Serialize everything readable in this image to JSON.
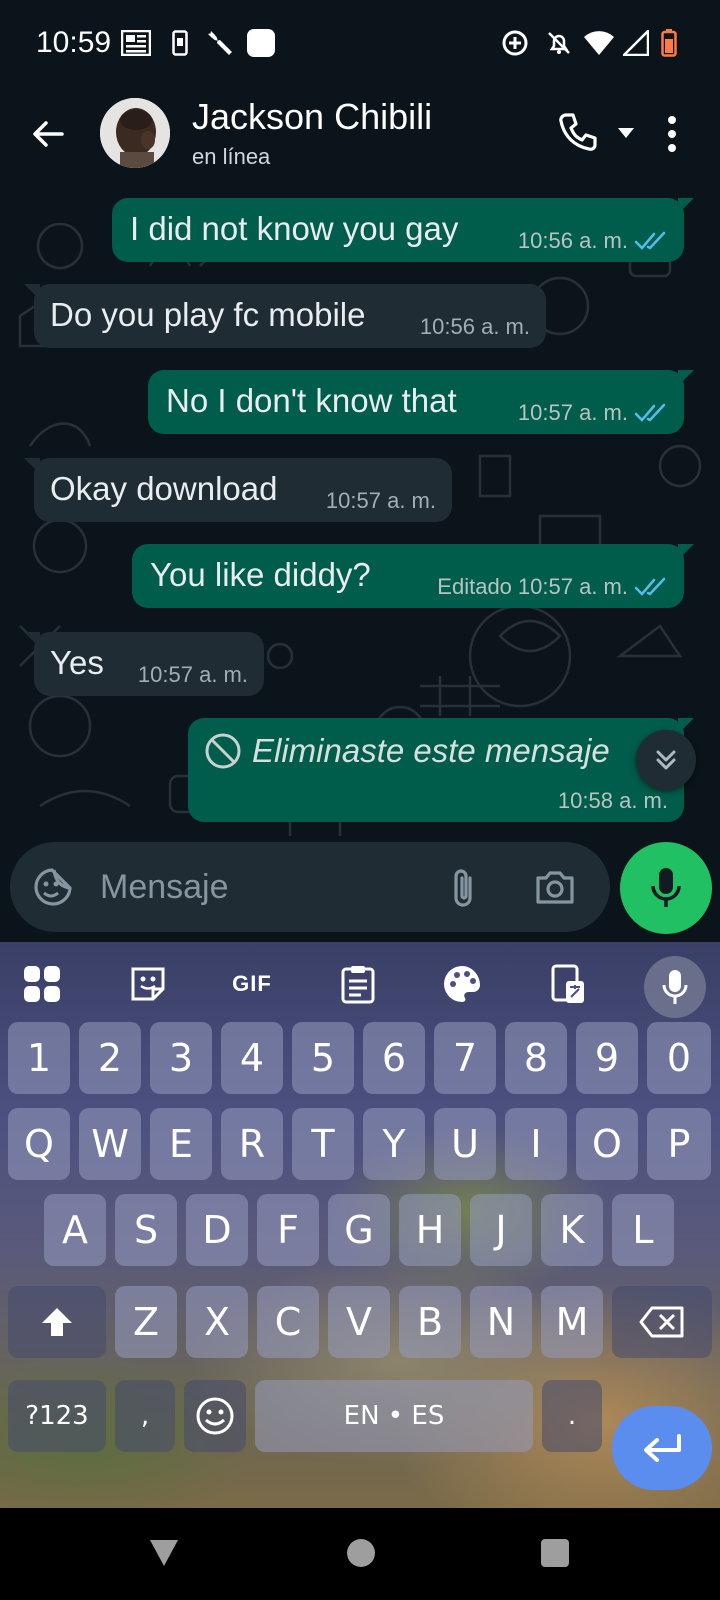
{
  "status_bar": {
    "time": "10:59",
    "icons": [
      "newspaper-icon",
      "phone-small-icon",
      "wrench-icon",
      "square-app-icon",
      "data-saver-icon",
      "notifications-off-icon",
      "wifi-icon",
      "signal-icon",
      "battery-icon"
    ]
  },
  "header": {
    "contact_name": "Jackson Chibili",
    "status": "en línea",
    "accent": "#21c063"
  },
  "messages": [
    {
      "direction": "out",
      "text": "I did not know you gay",
      "time": "10:56 a. m.",
      "read": true
    },
    {
      "direction": "in",
      "text": "Do you play fc mobile",
      "time": "10:56 a. m."
    },
    {
      "direction": "out",
      "text": "No I don't know that",
      "time": "10:57 a. m.",
      "read": true
    },
    {
      "direction": "in",
      "text": "Okay download",
      "time": "10:57 a. m."
    },
    {
      "direction": "out",
      "text": "You like diddy?",
      "edited": "Editado",
      "time": "10:57 a. m.",
      "read": true
    },
    {
      "direction": "in",
      "text": "Yes",
      "time": "10:57 a. m."
    },
    {
      "direction": "out",
      "text": "Eliminaste este mensaje",
      "time": "10:58 a. m.",
      "deleted": true
    }
  ],
  "compose": {
    "placeholder": "Mensaje"
  },
  "keyboard": {
    "toolbar": [
      "apps-grid-icon",
      "sticker-icon",
      "gif-icon",
      "clipboard-icon",
      "palette-icon",
      "translate-icon",
      "mic-icon"
    ],
    "gif_label": "GIF",
    "row_numbers": [
      "1",
      "2",
      "3",
      "4",
      "5",
      "6",
      "7",
      "8",
      "9",
      "0"
    ],
    "row_1": [
      "Q",
      "W",
      "E",
      "R",
      "T",
      "Y",
      "U",
      "I",
      "O",
      "P"
    ],
    "row_2": [
      "A",
      "S",
      "D",
      "F",
      "G",
      "H",
      "J",
      "K",
      "L"
    ],
    "row_3": [
      "Z",
      "X",
      "C",
      "V",
      "B",
      "N",
      "M"
    ],
    "symbols_key": "?123",
    "comma_key": ",",
    "space_label": "EN • ES",
    "period_key": "."
  },
  "nav": [
    "back-triangle-icon",
    "home-circle-icon",
    "recents-square-icon"
  ]
}
